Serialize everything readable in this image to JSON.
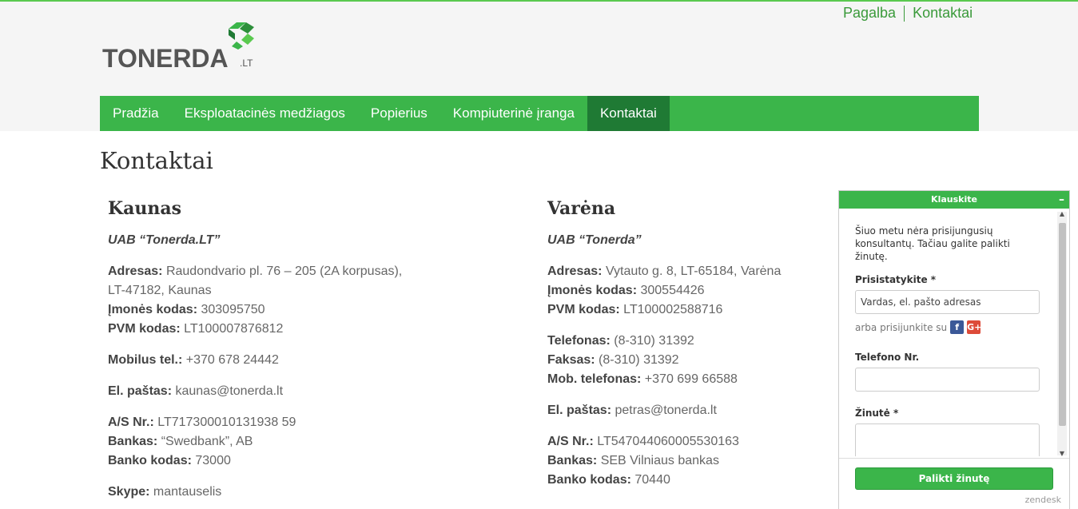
{
  "utility_nav": {
    "help": "Pagalba",
    "contacts": "Kontaktai"
  },
  "logo": {
    "word": "TONERDA",
    "tld": ".LT"
  },
  "main_nav": [
    {
      "label": "Pradžia"
    },
    {
      "label": "Eksploatacinės medžiagos"
    },
    {
      "label": "Popierius"
    },
    {
      "label": "Kompiuterinė įranga"
    },
    {
      "label": "Kontaktai",
      "active": true
    }
  ],
  "page_title": "Kontaktai",
  "kaunas": {
    "city": "Kaunas",
    "company": "UAB “Tonerda.LT”",
    "address_label": "Adresas:",
    "address_line1": "Raudondvario pl. 76 – 205 (2A korpusas),",
    "address_line2": "LT-47182, Kaunas",
    "code_label": "Įmonės kodas:",
    "code": "303095750",
    "vat_label": "PVM kodas:",
    "vat": "LT100007876812",
    "mobile_label": "Mobilus tel.:",
    "mobile": "+370 678 24442",
    "email_label": "El. paštas:",
    "email": "kaunas@tonerda.lt",
    "account_label": "A/S Nr.:",
    "account": "LT717300010131938 59",
    "bank_label": "Bankas:",
    "bank": "“Swedbank”, AB",
    "bank_code_label": "Banko kodas:",
    "bank_code": "73000",
    "skype_label": "Skype:",
    "skype": "mantauselis"
  },
  "varena": {
    "city": "Varėna",
    "company": "UAB “Tonerda”",
    "address_label": "Adresas:",
    "address": "Vytauto g. 8, LT-65184, Varėna",
    "code_label": "Įmonės kodas:",
    "code": "300554426",
    "vat_label": "PVM kodas:",
    "vat": "LT100002588716",
    "phone_label": "Telefonas:",
    "phone": "(8-310) 31392",
    "fax_label": "Faksas:",
    "fax": "(8-310) 31392",
    "mobile_label": "Mob. telefonas:",
    "mobile": "+370 699 66588",
    "email_label": "El. paštas:",
    "email": "petras@tonerda.lt",
    "account_label": "A/S Nr.:",
    "account": "LT547044060005530163",
    "bank_label": "Bankas:",
    "bank": "SEB Vilniaus bankas",
    "bank_code_label": "Banko kodas:",
    "bank_code": "70440"
  },
  "widget": {
    "title": "Klauskite",
    "minimize": "–",
    "notice": "Šiuo metu nėra prisijungusių konsultantų. Tačiau galite palikti žinutę.",
    "name_label": "Prisistatykite *",
    "name_placeholder": "Vardas, el. pašto adresas",
    "social_text": "arba prisijunkite su",
    "facebook_glyph": "f",
    "google_glyph": "G+",
    "phone_label": "Telefono Nr.",
    "message_label": "Žinutė *",
    "submit_label": "Palikti žinutę",
    "brand": "zendesk"
  },
  "colors": {
    "accent": "#3bb54a",
    "active_nav": "#1f7a34",
    "link": "#3a9a3a"
  }
}
